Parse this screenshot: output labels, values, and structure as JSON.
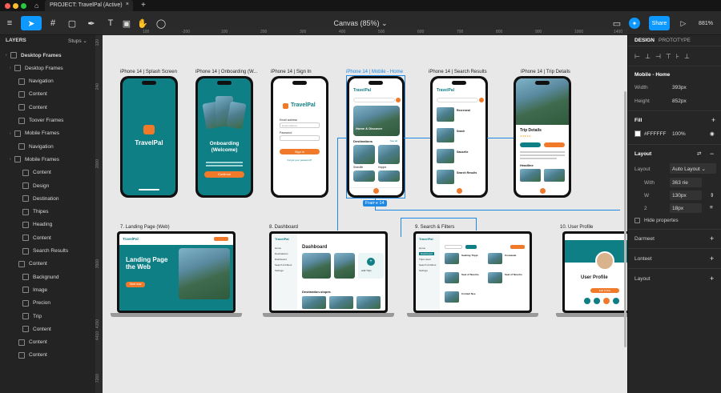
{
  "window": {
    "project_tab": "PROJECT: TravelPal (Active)",
    "canvas_title": "Canvas (85%)",
    "share_label": "Share",
    "zoom": "881%"
  },
  "layers": {
    "header": "LAYERS",
    "pages_label": "Stups",
    "items": [
      {
        "label": "Desktop Frames",
        "indent": 0
      },
      {
        "label": "Desktop Frames",
        "indent": 1
      },
      {
        "label": "Navigation",
        "indent": 2
      },
      {
        "label": "Content",
        "indent": 2
      },
      {
        "label": "Content",
        "indent": 2
      },
      {
        "label": "Toover Frames",
        "indent": 2
      },
      {
        "label": "Mobile Frames",
        "indent": 1
      },
      {
        "label": "Navigation",
        "indent": 2
      },
      {
        "label": "Mobile Frames",
        "indent": 1
      },
      {
        "label": "Content",
        "indent": 3
      },
      {
        "label": "Design",
        "indent": 3
      },
      {
        "label": "Destination",
        "indent": 3
      },
      {
        "label": "Thipes",
        "indent": 3
      },
      {
        "label": "Heading",
        "indent": 3
      },
      {
        "label": "Content",
        "indent": 3
      },
      {
        "label": "Search Results",
        "indent": 3
      },
      {
        "label": "Content",
        "indent": 2
      },
      {
        "label": "Backgnund",
        "indent": 3
      },
      {
        "label": "Image",
        "indent": 3
      },
      {
        "label": "Precion",
        "indent": 3
      },
      {
        "label": "Trip",
        "indent": 3
      },
      {
        "label": "Content",
        "indent": 3
      },
      {
        "label": "Content",
        "indent": 2
      },
      {
        "label": "Content",
        "indent": 2
      }
    ]
  },
  "ruler": {
    "top": [
      "100",
      "-200",
      "100",
      "200",
      "300",
      "400",
      "500",
      "600",
      "700",
      "800",
      "900",
      "1000",
      "1400"
    ],
    "left": [
      "120",
      "240",
      "2000",
      "3500",
      "4150",
      "4410",
      "7260"
    ]
  },
  "frames": {
    "phones": [
      {
        "label": "iPhone 14 | Splash Screen"
      },
      {
        "label": "iPhone 14 | Onboarding (W..."
      },
      {
        "label": "iPhone 14 | Sign In"
      },
      {
        "label": "iPhone 14 | Mobile - Home"
      },
      {
        "label": "iPhone 14 | Search Results"
      },
      {
        "label": "iPhone 14 | Trip Details"
      }
    ],
    "laptops": [
      {
        "label": "7. Landing Page (Web)"
      },
      {
        "label": "8. Dashboard"
      },
      {
        "label": "9. Search & Filters"
      },
      {
        "label": "10. User Profile"
      }
    ],
    "selected_badge": "Frame 14"
  },
  "screens": {
    "brand": "TravelPal",
    "onboarding_title": "Onboarding (Welcome)",
    "onboarding_button": "Continue",
    "signin_email": "Email address",
    "signin_password": "Password",
    "signin_button": "Sign in",
    "signin_forgot": "Forgot your password?",
    "home_hero_title": "Home & Discover",
    "home_section": "Destinations",
    "home_see_all": "See all",
    "home_card1": "Seaville",
    "home_card2": "Hoppe",
    "search_items": [
      "Recreneal",
      "Seach",
      "Sausetle",
      "Search Results"
    ],
    "trip_title": "Trip Details",
    "trip_heading": "Headline",
    "landing_title": "Landing Page the Web",
    "landing_cta": "Start now",
    "dashboard_title": "Dashboard",
    "dashboard_section": "Destination-slopes",
    "dashboard_nav": [
      "Home",
      "Destinations",
      "Dashboard",
      "Search & Filters",
      "Settings"
    ],
    "dashboard_card": "Add Trips",
    "search_nav": [
      "Home",
      "Dashboard",
      "Trips Used",
      "Search & Filters",
      "Settings"
    ],
    "search_items_web": [
      "Seaking Trippi",
      "Coneaade",
      "Seat of Nevohe",
      "Seat of Nevoho",
      "Contact Nee"
    ],
    "profile_title": "User Profile",
    "profile_btn": "Edit Profile"
  },
  "inspector": {
    "tabs": [
      "DESIGN",
      "PROTOTYPE"
    ],
    "frame_name": "Mobile - Home",
    "width_label": "Width",
    "width_value": "393px",
    "height_label": "Height",
    "height_value": "852px",
    "fill_label": "Fill",
    "fill_hex": "#FFFFFF",
    "fill_opacity": "100%",
    "layout_label": "Layout",
    "layout_sub_label": "Layout",
    "layout_value": "Auto Layout",
    "with_label": "With",
    "with_value": "363 rie",
    "w_label": "W",
    "w_value": "130px",
    "two_label": "2",
    "two_value": "18px",
    "hide_label": "Hide propertes",
    "section2": "Darmeet",
    "section3": "Lonteet",
    "section4": "Layout"
  },
  "colors": {
    "accent": "#0d99ff",
    "teal": "#0f7f86",
    "orange": "#f07a2a"
  }
}
